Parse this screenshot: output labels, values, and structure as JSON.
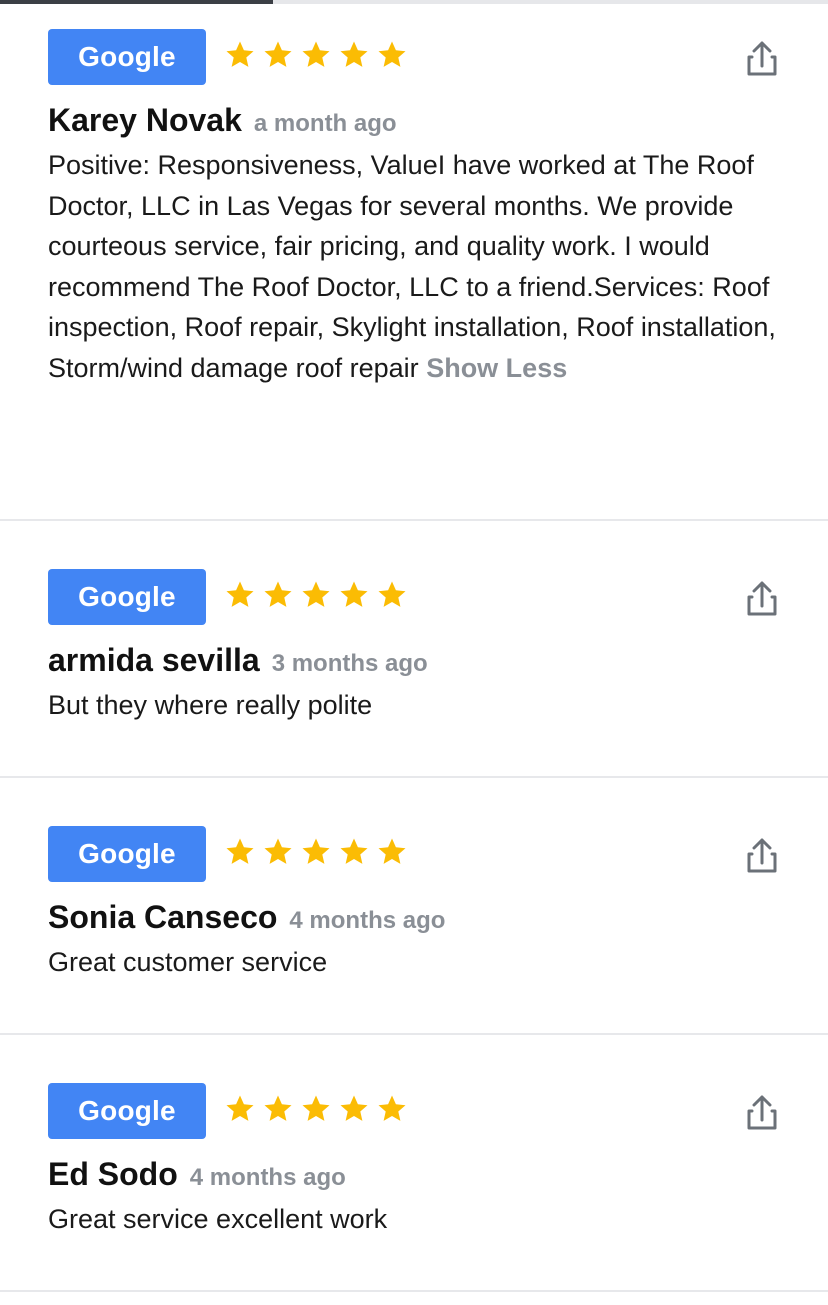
{
  "progress": {
    "fraction": 0.33
  },
  "colors": {
    "badge": "#4285f4",
    "star": "#fbbc04",
    "meta": "#8a8f96",
    "divider": "#e7e8eb"
  },
  "reviews": [
    {
      "source": "Google",
      "rating": 5,
      "author": "Karey Novak",
      "time": "a month ago",
      "text": "Positive: Responsiveness, ValueI have worked at The Roof Doctor, LLC in Las Vegas for several months. We provide courteous service, fair pricing, and quality work.  I would recommend The Roof Doctor, LLC to a friend.Services: Roof inspection, Roof repair, Skylight installation, Roof installation, Storm/wind damage roof repair",
      "toggle": "Show Less",
      "share_icon": "share-icon"
    },
    {
      "source": "Google",
      "rating": 5,
      "author": "armida sevilla",
      "time": "3 months ago",
      "text": "But they where really polite",
      "share_icon": "share-icon"
    },
    {
      "source": "Google",
      "rating": 5,
      "author": "Sonia Canseco",
      "time": "4 months ago",
      "text": "Great customer service",
      "share_icon": "share-icon"
    },
    {
      "source": "Google",
      "rating": 5,
      "author": "Ed Sodo",
      "time": "4 months ago",
      "text": "Great service excellent work",
      "share_icon": "share-icon"
    }
  ]
}
